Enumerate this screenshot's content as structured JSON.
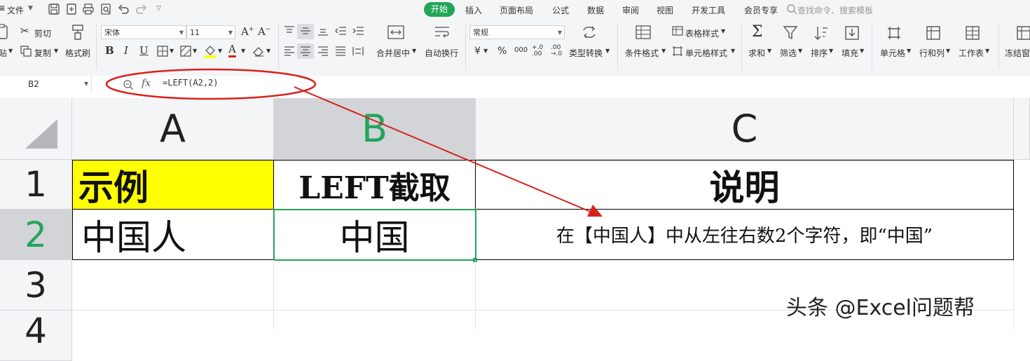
{
  "menu": {
    "file_label": "文件",
    "tabs": [
      "开始",
      "插入",
      "页面布局",
      "公式",
      "数据",
      "审阅",
      "视图",
      "开发工具",
      "会员专享"
    ],
    "active_tab": "开始",
    "search_placeholder": "查找命令、搜索模板"
  },
  "ribbon": {
    "cut": "剪切",
    "paste_partial": "贴",
    "copy": "复制",
    "format_painter": "格式刷",
    "font_name": "宋体",
    "font_size": "11",
    "number_format": "常规",
    "merge_center": "合并居中",
    "wrap_text": "自动换行",
    "type_convert": "类型转换",
    "conditional_format": "条件格式",
    "table_style": "表格样式",
    "cell_style": "单元格样式",
    "sum": "求和",
    "filter": "筛选",
    "sort": "排序",
    "fill": "填充",
    "cells": "单元格",
    "rows_cols": "行和列",
    "worksheet": "工作表",
    "freeze_partial": "冻结窗"
  },
  "formula_bar": {
    "cell_ref": "B2",
    "fx_label": "fx",
    "formula": "=LEFT(A2,2)"
  },
  "sheet": {
    "columns": [
      "A",
      "B",
      "C"
    ],
    "selected_column": "B",
    "rows": [
      "1",
      "2",
      "3",
      "4"
    ],
    "selected_row": "2",
    "cells": {
      "A1": "示例",
      "B1": "LEFT截取",
      "C1": "说明",
      "A2": "中国人",
      "B2": "中国",
      "C2": "在【中国人】中从左往右数2个字符，即“中国”"
    }
  },
  "watermark": "头条 @Excel问题帮",
  "colors": {
    "accent_green": "#23a55a",
    "header_yellow": "#ffff00",
    "annotation_red": "#d9211c"
  }
}
